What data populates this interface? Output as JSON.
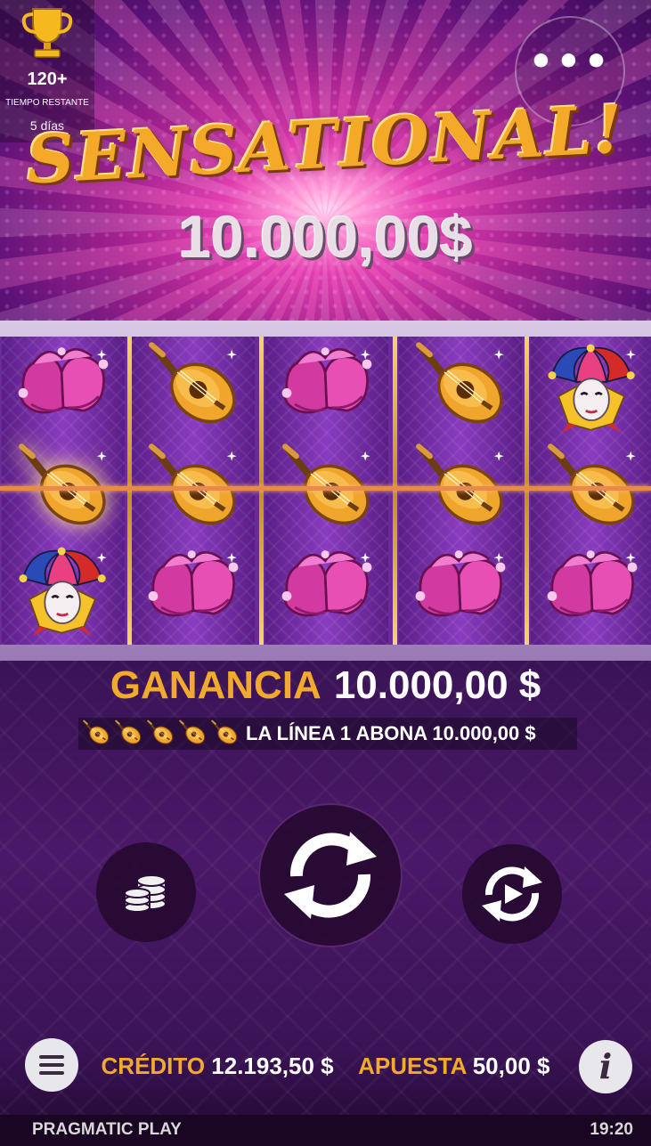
{
  "tournament": {
    "count": "120+",
    "time_label": "TIEMPO RESTANTE",
    "days": "5 días",
    "icon": "trophy-icon"
  },
  "menu_button": {
    "icon": "more-dots-icon",
    "label": "•••"
  },
  "banner": {
    "title": "SENSATIONAL!",
    "amount": "10.000,00$"
  },
  "reels": {
    "columns": [
      [
        "jester-shoes",
        "lute",
        "jester-mask"
      ],
      [
        "lute",
        "lute",
        "jester-shoes"
      ],
      [
        "jester-shoes",
        "lute",
        "jester-shoes"
      ],
      [
        "lute",
        "lute",
        "jester-shoes"
      ],
      [
        "jester-mask",
        "lute",
        "jester-shoes"
      ]
    ],
    "payline": 2
  },
  "win": {
    "label": "GANANCIA",
    "value": "10.000,00 $"
  },
  "line_pay": {
    "text": "LA LÍNEA 1 ABONA 10.000,00 $",
    "symbol_count": 5
  },
  "controls": {
    "spin_icon": "spin-icon",
    "bet_icon": "coins-icon",
    "autoplay_icon": "autoplay-icon"
  },
  "balance": {
    "credit_label": "CRÉDITO",
    "credit_value": "12.193,50 $",
    "bet_label": "APUESTA",
    "bet_value": "50,00 $"
  },
  "info_label": "i",
  "footer": {
    "brand": "PRAGMATIC PLAY",
    "time": "19:20"
  },
  "colors": {
    "gold": "#f2aa2c",
    "reel_purple": "#6a2a98",
    "bg_purple": "#3a1356"
  }
}
